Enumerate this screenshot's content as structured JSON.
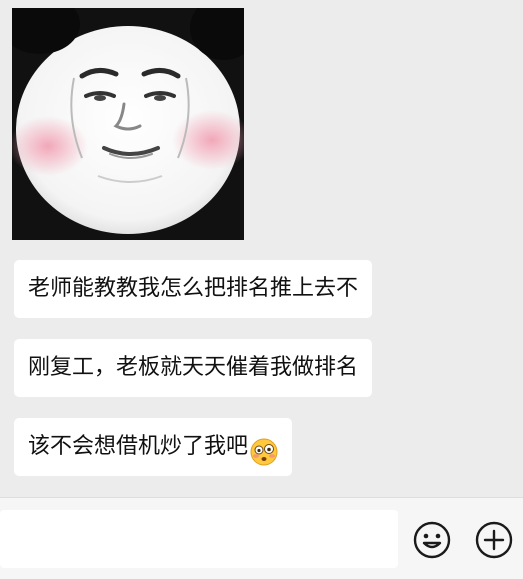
{
  "messages": [
    {
      "text": "老师能教教我怎么把排名推上去不"
    },
    {
      "text": "刚复工，老板就天天催着我做排名"
    },
    {
      "text": "该不会想借机炒了我吧",
      "emoji": "flushed-face-icon"
    }
  ],
  "sticker": {
    "icon": "panda-meme-sticker",
    "blush_color": "#f2a3b5"
  },
  "input": {
    "value": "",
    "placeholder": ""
  },
  "toolbar": {
    "emoji_icon": "smiley-icon",
    "plus_icon": "plus-circle-icon"
  },
  "colors": {
    "background": "#ececec",
    "bubble": "#ffffff",
    "text": "#111111",
    "emoji_face": "#ffc83d"
  }
}
